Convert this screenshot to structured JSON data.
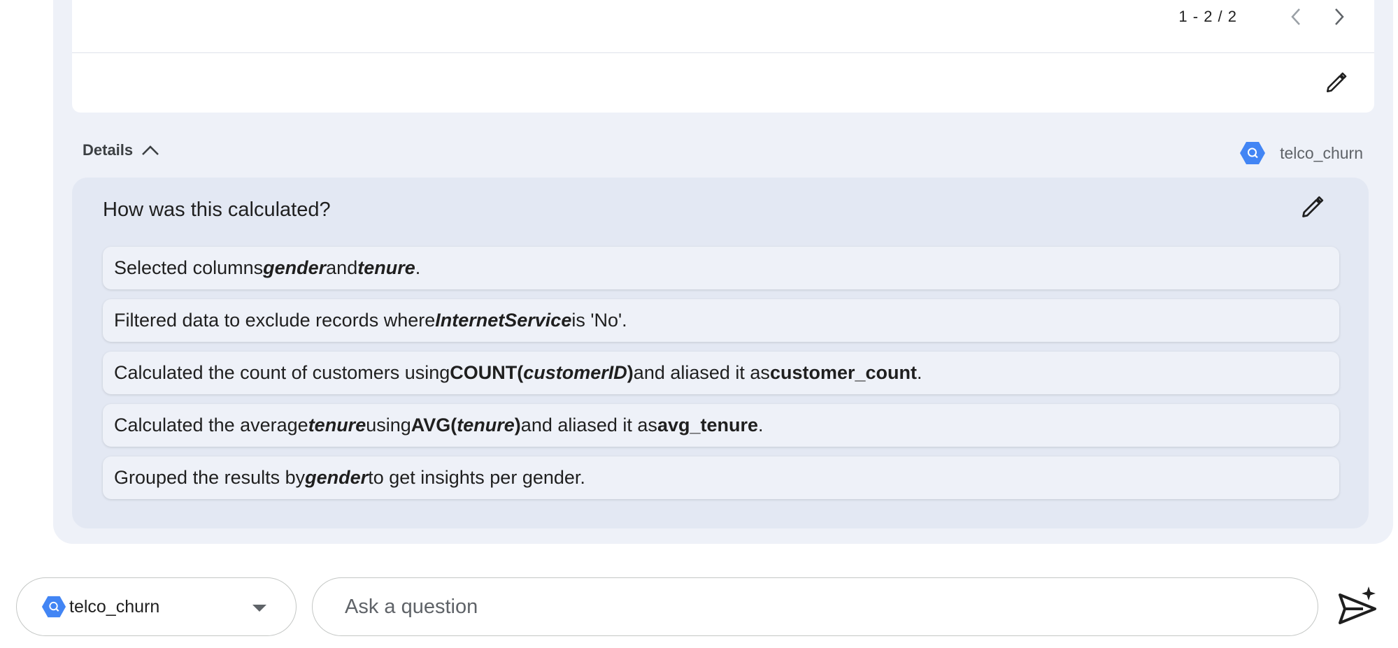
{
  "results_table": {
    "pagination": {
      "range_label": "1 - 2 / 2",
      "prev_icon": "chevron-left-icon",
      "next_icon": "chevron-right-icon"
    },
    "edit_icon": "pencil-icon"
  },
  "details": {
    "toggle_label": "Details",
    "toggle_icon": "chevron-up-icon",
    "source_name": "telco_churn",
    "source_icon": "bigquery-hexagon-icon"
  },
  "calculation": {
    "title": "How was this calculated?",
    "edit_icon": "pencil-icon",
    "steps": [
      {
        "p1": "Selected columns ",
        "p2": "gender",
        "p3": " and ",
        "p4": "tenure",
        "p5": "."
      },
      {
        "p1": "Filtered data to exclude records where ",
        "p2": "InternetService",
        "p3": " is 'No'."
      },
      {
        "p1": "Calculated the count of customers using ",
        "p2": "COUNT(",
        "p3": "customerID",
        "p4": ")",
        "p5": " and aliased it as ",
        "p6": "customer_count",
        "p7": "."
      },
      {
        "p1": "Calculated the average ",
        "p2": "tenure",
        "p3": " using ",
        "p4": "AVG(",
        "p5": "tenure",
        "p6": ")",
        "p7": " and aliased it as ",
        "p8": "avg_tenure",
        "p9": "."
      },
      {
        "p1": "Grouped the results by ",
        "p2": "gender",
        "p3": " to get insights per gender."
      }
    ]
  },
  "input_bar": {
    "source_selected": "telco_churn",
    "source_icon": "bigquery-hexagon-icon",
    "dropdown_icon": "caret-down-icon",
    "placeholder": "Ask a question",
    "value": "",
    "send_icon": "send-sparkle-icon"
  },
  "colors": {
    "accent_blue": "#4285f4",
    "card_bg": "#eef1f8",
    "calc_bg": "#e3e8f3"
  }
}
